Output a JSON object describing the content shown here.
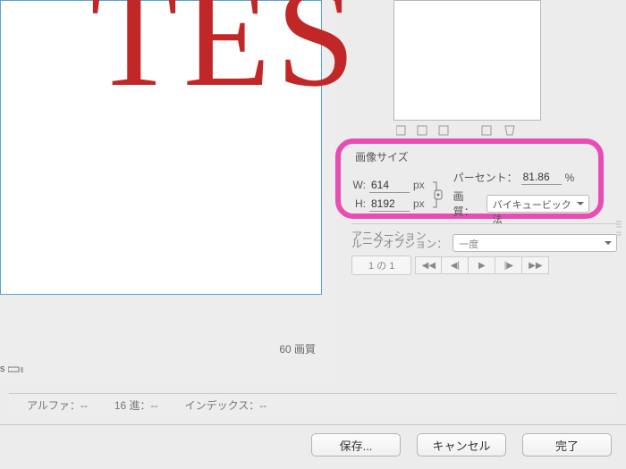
{
  "canvas_text": "TES",
  "preview": {
    "quality_label": "60 画質"
  },
  "thumb_tools": "⬚  ⬚  ⬚     ⬚  ⬚",
  "image_size": {
    "title": "画像サイズ",
    "w_label": "W:",
    "w_value": "614",
    "h_label": "H:",
    "h_value": "8192",
    "unit": "px",
    "percent_label": "パーセント：",
    "percent_value": "81.86",
    "percent_unit": "%",
    "quality_label": "画質：",
    "quality_value": "バイキュービック法"
  },
  "animation": {
    "title": "アニメーション"
  },
  "loop": {
    "label": "ループオプション：",
    "value": "一度"
  },
  "pager": {
    "count": "1 の 1"
  },
  "info": {
    "alpha": "アルファ：--",
    "hex": "16 進：--",
    "index": "インデックス：--"
  },
  "buttons": {
    "save": "保存...",
    "cancel": "キャンセル",
    "done": "完了"
  },
  "ruler_suffix": "s"
}
